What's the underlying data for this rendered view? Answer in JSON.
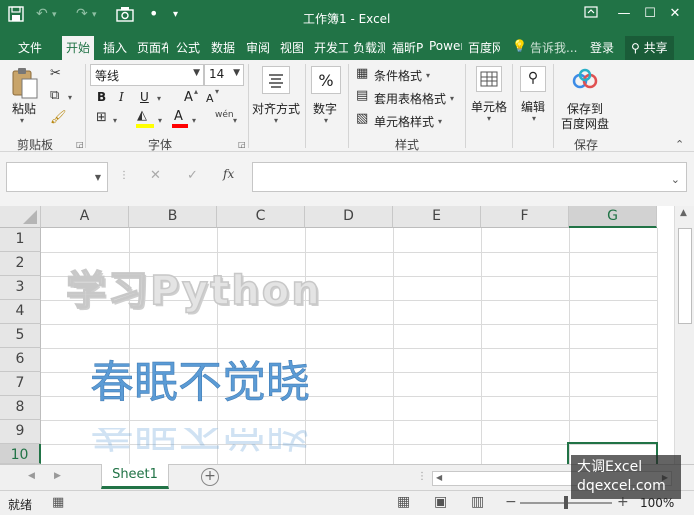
{
  "window": {
    "title": "工作簿1 - Excel",
    "quick_access": [
      "save-icon",
      "undo-icon",
      "redo-icon",
      "camera-icon",
      "dot-icon",
      "customize-icon"
    ],
    "controls": [
      "ribbon-display-icon",
      "minimize-icon",
      "maximize-icon",
      "close-icon"
    ]
  },
  "tabs": {
    "items": [
      "文件",
      "开始",
      "插入",
      "页面布局",
      "公式",
      "数据",
      "审阅",
      "视图",
      "开发工具",
      "负载测试",
      "福昕PDF",
      "Power Pivot",
      "百度网盘"
    ],
    "active": "开始",
    "tell_me": "告诉我...",
    "login": "登录",
    "share": "共享"
  },
  "ribbon": {
    "clipboard": {
      "paste": "粘贴",
      "group": "剪贴板"
    },
    "font": {
      "name": "等线",
      "size": "14",
      "bold": "B",
      "italic": "I",
      "underline": "U",
      "grow": "A",
      "shrink": "A",
      "phonetic": "wén",
      "fill_color": "#FFFF00",
      "font_color": "#FF0000",
      "group": "字体"
    },
    "alignment": {
      "label": "对齐方式"
    },
    "number": {
      "label": "数字",
      "icon": "%"
    },
    "styles": {
      "conditional": "条件格式",
      "table": "套用表格格式",
      "cell": "单元格样式",
      "group": "样式"
    },
    "cells": {
      "label": "单元格"
    },
    "editing": {
      "label": "编辑"
    },
    "save": {
      "label1": "保存到",
      "label2": "百度网盘",
      "group": "保存"
    }
  },
  "formula_bar": {
    "name_box": "",
    "cancel": "✕",
    "enter": "✓",
    "fx": "fx",
    "content": ""
  },
  "grid": {
    "columns": [
      "A",
      "B",
      "C",
      "D",
      "E",
      "F",
      "G"
    ],
    "selected_column": "G",
    "rows": [
      "1",
      "2",
      "3",
      "4",
      "5",
      "6",
      "7",
      "8",
      "9",
      "10"
    ],
    "selected_row": "10",
    "shape_text_1": "学习Python",
    "shape_text_2": "春眠不觉晓"
  },
  "sheets": {
    "tabs": [
      "Sheet1"
    ],
    "active": "Sheet1"
  },
  "status": {
    "ready": "就绪",
    "zoom": "100%"
  },
  "watermark": {
    "line1": "大调Excel",
    "line2": "dqexcel.com"
  }
}
